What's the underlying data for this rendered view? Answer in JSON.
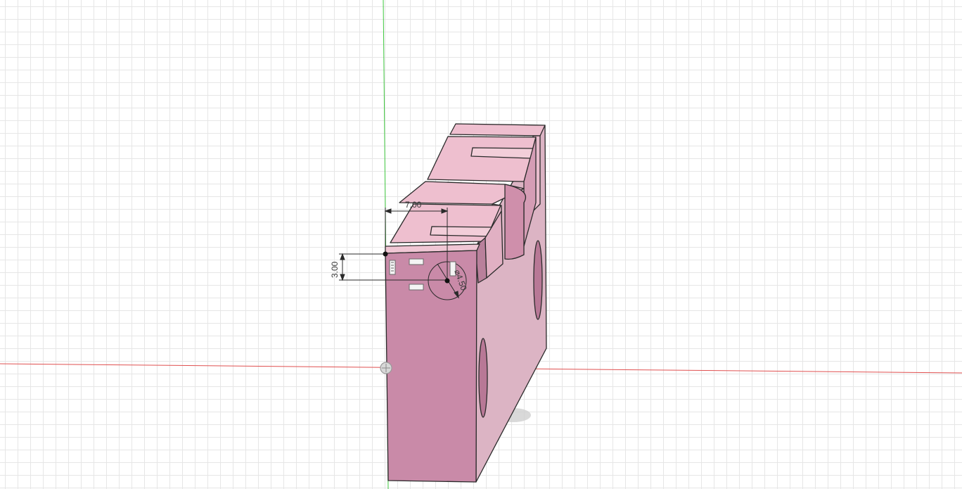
{
  "canvas": {
    "background_color": "#ffffff",
    "grid_color": "#e6e6e6",
    "x_axis_color": "#e05050",
    "y_axis_color": "#3ec83e",
    "body_color": "#c98aa8",
    "body_top_color": "#e6b8c8"
  },
  "dimensions": {
    "width_label": "7.00",
    "height_label": "3.00",
    "diameter_label": "⌀4.50"
  },
  "icons": {
    "origin": "origin-marker-icon",
    "constraints": "sketch-constraint-icon"
  }
}
